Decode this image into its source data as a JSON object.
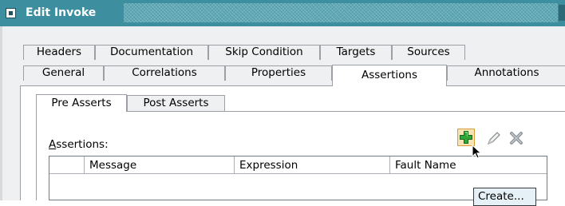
{
  "window": {
    "title": "Edit Invoke"
  },
  "tabs": {
    "row1": [
      "Headers",
      "Documentation",
      "Skip Condition",
      "Targets",
      "Sources"
    ],
    "row2": [
      "General",
      "Correlations",
      "Properties",
      "Assertions",
      "Annotations"
    ],
    "active": "Assertions"
  },
  "subtabs": {
    "items": [
      "Pre Asserts",
      "Post Asserts"
    ],
    "active": "Pre Asserts"
  },
  "assertions": {
    "label_mnemonic": "A",
    "label_rest": "ssertions:",
    "toolbar": {
      "add_icon": "add-plus-icon",
      "edit_icon": "pencil-icon",
      "delete_icon": "delete-x-icon"
    },
    "columns": [
      "",
      "Message",
      "Expression",
      "Fault Name"
    ],
    "rows": []
  },
  "tooltip": {
    "text": "Create..."
  },
  "colors": {
    "titlebar": "#3d8fa0",
    "add_button_bg": "#f6e3b6",
    "add_icon": "#2fa53a",
    "tooltip_bg": "#e5f1f6"
  }
}
